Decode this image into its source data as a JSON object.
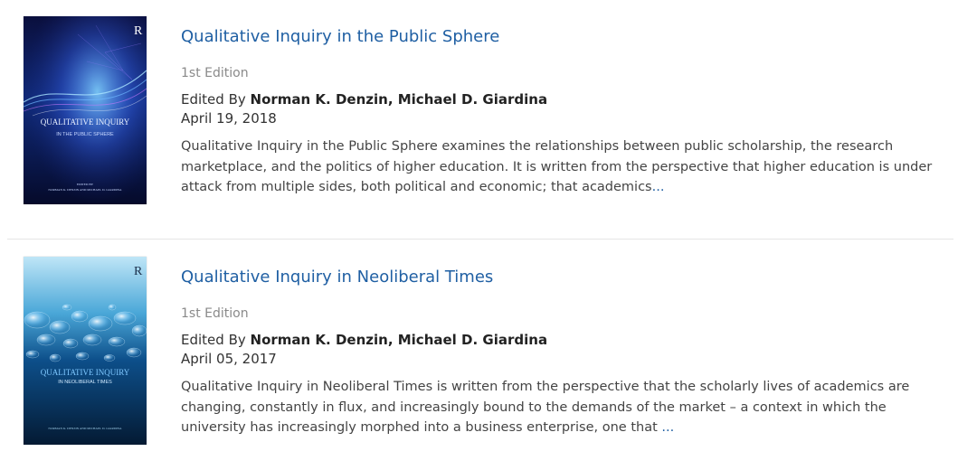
{
  "results": [
    {
      "cover": {
        "publisher_mark": "R",
        "title_line1": "QUALITATIVE INQUIRY",
        "title_line2": "IN THE PUBLIC SPHERE",
        "edited_by": "EDITED BY",
        "editors": "NORMAN K. DENZIN AND MICHAEL D. GIARDINA"
      },
      "title": "Qualitative Inquiry in the Public Sphere",
      "edition": "1st Edition",
      "editors_prefix": "Edited By ",
      "editors": "Norman K. Denzin, Michael D. Giardina",
      "date": "April 19, 2018",
      "description": "Qualitative Inquiry in the Public Sphere examines the relationships between public scholarship, the research marketplace, and the politics of higher education.     It is written from the perspective that higher education is under attack from multiple sides, both political and economic; that academics",
      "ellipsis": "..."
    },
    {
      "cover": {
        "publisher_mark": "R",
        "title_line1": "QUALITATIVE INQUIRY",
        "title_line2": "IN NEOLIBERAL TIMES",
        "editors": "NORMAN K. DENZIN AND MICHAEL D. GIARDINA"
      },
      "title": "Qualitative Inquiry in Neoliberal Times",
      "edition": "1st Edition",
      "editors_prefix": "Edited By ",
      "editors": "Norman K. Denzin, Michael D. Giardina",
      "date": "April 05, 2017",
      "description": "Qualitative Inquiry in Neoliberal Times is written from the perspective that the scholarly lives of academics are changing, constantly in flux, and increasingly bound to the demands of the market – a context in which the university has increasingly morphed into a business enterprise, one that ",
      "ellipsis": "..."
    }
  ],
  "colors": {
    "link": "#1f5fa3",
    "muted": "#8a8a8a",
    "text": "#444444",
    "divider": "#e6e6e6"
  }
}
